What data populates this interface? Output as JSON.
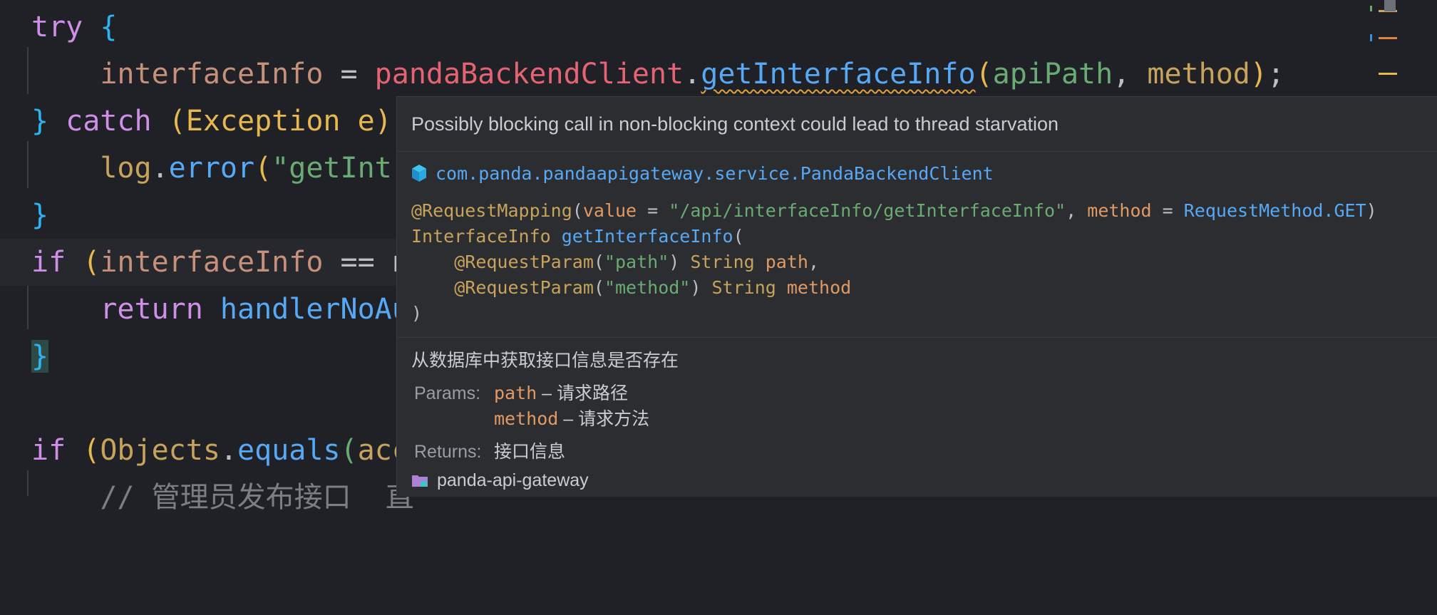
{
  "editor": {
    "lines": {
      "l1": {
        "try": "try",
        "ob": "{"
      },
      "l2": {
        "var": "interfaceInfo",
        "eq": " = ",
        "obj": "pandaBackendClient",
        "dot": ".",
        "meth": "getInterfaceInfo",
        "op": "(",
        "a1": "apiPath",
        "comma": ", ",
        "a2": "method",
        "cp": ")",
        "semi": ";"
      },
      "l3": {
        "cb": "}",
        "catch": " catch ",
        "op": "(",
        "type": "Exception e",
        "cp": ")"
      },
      "l4": {
        "obj": "log",
        "dot": ".",
        "meth": "error",
        "op": "(",
        "str": "\"getInt"
      },
      "l5": {
        "cb": "}"
      },
      "l6": {
        "if": "if ",
        "op": "(",
        "var": "interfaceInfo",
        "rest": " == n"
      },
      "l7": {
        "ret": "return ",
        "call": "handlerNoAu"
      },
      "l8": {
        "cb": "}"
      },
      "l10": {
        "if": "if ",
        "op": "(",
        "cls": "Objects",
        "dot": ".",
        "meth": "equals",
        "op2": "(",
        "arg": "acc"
      },
      "l11": {
        "cmt": "// 管理员发布接口  直"
      }
    }
  },
  "popup": {
    "warning": "Possibly blocking call in non-blocking context could lead to thread starvation",
    "class_fqn": "com.panda.pandaapigateway.service.PandaBackendClient",
    "signature": {
      "annotation": "@RequestMapping",
      "value_key": "value",
      "value": "\"/api/interfaceInfo/getInterfaceInfo\"",
      "method_key": "method",
      "method_val": "RequestMethod.GET",
      "return_type": "InterfaceInfo",
      "fn_name": "getInterfaceInfo",
      "param_annotation": "@RequestParam",
      "p1_name_str": "\"path\"",
      "p1_type": "String",
      "p1_name": "path",
      "p2_name_str": "\"method\"",
      "p2_type": "String",
      "p2_name": "method"
    },
    "description": "从数据库中获取接口信息是否存在",
    "params_label": "Params:",
    "params": [
      {
        "name": "path",
        "desc": " – 请求路径"
      },
      {
        "name": "method",
        "desc": " – 请求方法"
      }
    ],
    "returns_label": "Returns:",
    "returns": "接口信息",
    "module": "panda-api-gateway"
  },
  "icons": {
    "class": "class-cube-icon",
    "module": "module-folder-icon"
  },
  "colors": {
    "background": "#1f2126",
    "popup": "#2b2d31",
    "keyword": "#cf8ee8",
    "method": "#57a8f5",
    "warning_underline": "#e0a33a"
  }
}
